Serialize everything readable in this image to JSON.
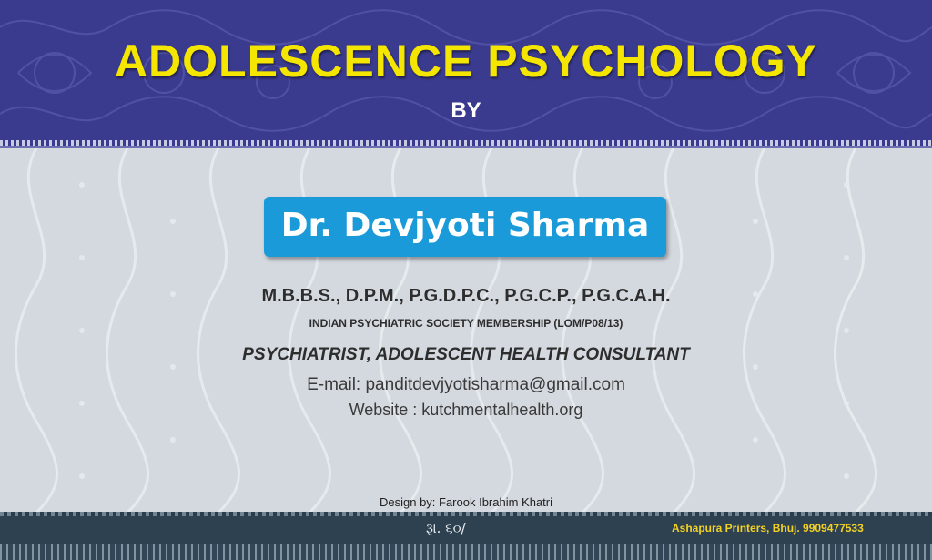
{
  "banner": {
    "title": "ADOLESCENCE PSYCHOLOGY",
    "by": "BY"
  },
  "author": {
    "name": "Dr. Devjyoti Sharma",
    "degrees": "M.B.B.S., D.P.M., P.G.D.P.C., P.G.C.P., P.G.C.A.H.",
    "membership": "INDIAN PSYCHIATRIC SOCIETY MEMBERSHIP (LOM/P08/13)",
    "role": "PSYCHIATRIST, ADOLESCENT HEALTH CONSULTANT",
    "email": "E-mail: panditdevjyotisharma@gmail.com",
    "website": "Website : kutchmentalhealth.org"
  },
  "credits": {
    "designer": "Design by: Farook Ibrahim Khatri"
  },
  "footer": {
    "price": "રૂા. ૬૦/",
    "printer": "Ashapura Printers, Bhuj. 9909477533"
  },
  "colors": {
    "banner": "#3a3a8e",
    "title": "#f4e600",
    "name_box": "#1a9ad9",
    "footer": "#2b3d4c",
    "printer_text": "#f3d224"
  }
}
